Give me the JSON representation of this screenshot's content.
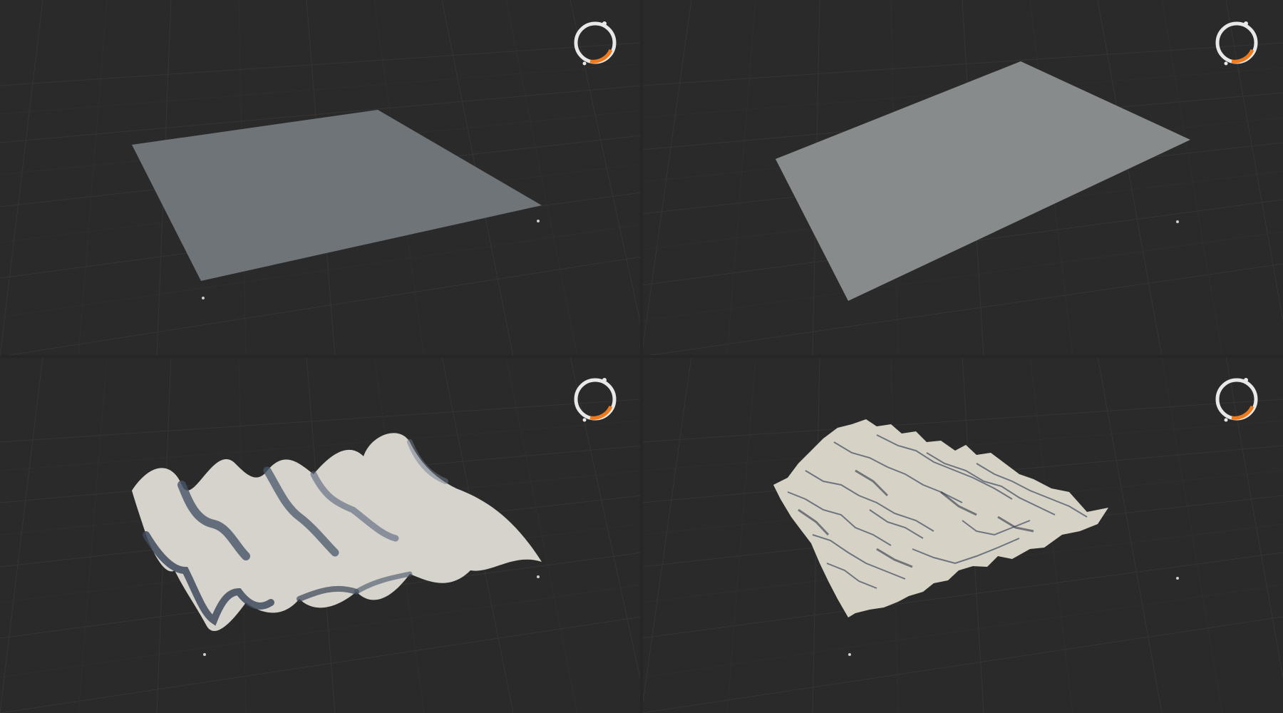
{
  "viewports": [
    {
      "id": "top-left",
      "object": "plane",
      "surface_color": "#6f7479",
      "gizmo_icon": "view-orbit-gizmo-icon"
    },
    {
      "id": "top-right",
      "object": "plane",
      "surface_color": "#878b8b",
      "gizmo_icon": "view-orbit-gizmo-icon"
    },
    {
      "id": "bottom-left",
      "object": "wave-surface",
      "surface_color": "#d5d3cc",
      "gizmo_icon": "view-orbit-gizmo-icon"
    },
    {
      "id": "bottom-right",
      "object": "noise-terrain",
      "surface_color": "#d6d2c6",
      "gizmo_icon": "view-orbit-gizmo-icon"
    }
  ],
  "colors": {
    "background": "#2a2a2a",
    "grid_minor": "#323232",
    "grid_major": "#3a3a3a",
    "gizmo_ring": "#e8e8e8",
    "gizmo_accent": "#f07a1a"
  }
}
